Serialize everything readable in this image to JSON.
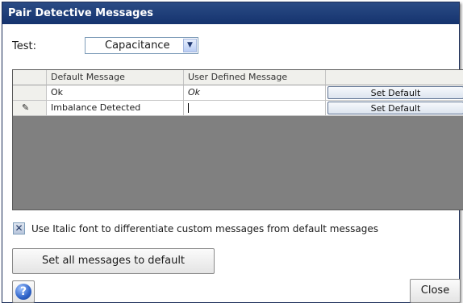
{
  "window": {
    "title": "Pair Detective Messages"
  },
  "test": {
    "label": "Test:",
    "selected": "Capacitance"
  },
  "table": {
    "headers": [
      "",
      "Default Message",
      "User Defined Message",
      ""
    ],
    "rows": [
      {
        "default": "Ok",
        "user": "Ok",
        "button": "Set Default"
      },
      {
        "default": "Imbalance Detected",
        "user": "",
        "button": "Set Default"
      }
    ]
  },
  "italic_option": {
    "label": "Use Italic font to differentiate custom messages from default messages",
    "checked": true
  },
  "buttons": {
    "set_all": "Set all messages to default",
    "close": "Close",
    "help": "?"
  },
  "icons": {
    "row_editing": "pencil-icon",
    "help": "help-icon",
    "checkbox": "x-mark-icon",
    "dropdown": "chevron-down-icon"
  },
  "colors": {
    "titlebar": "#1f3f7a",
    "grid_background": "#808080"
  }
}
